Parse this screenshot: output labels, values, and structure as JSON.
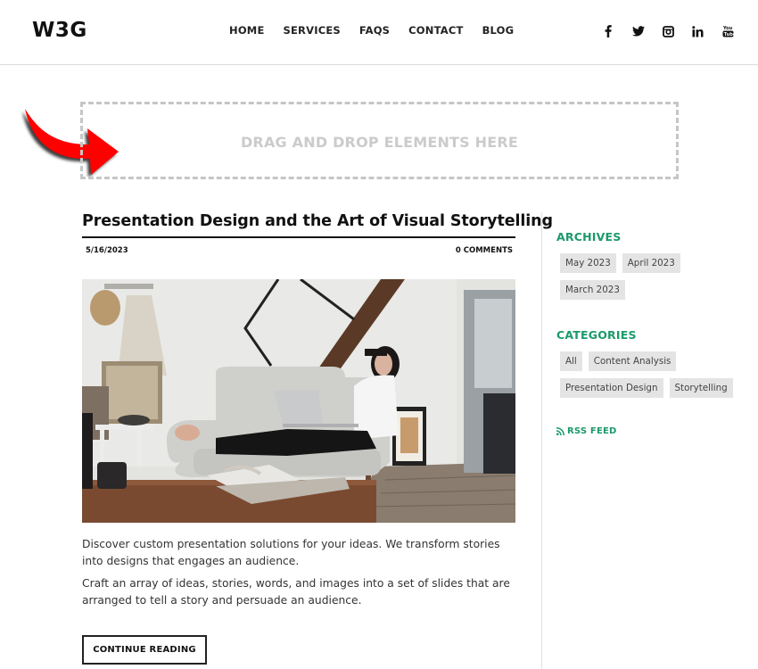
{
  "header": {
    "logo": "W3G",
    "nav": [
      "HOME",
      "SERVICES",
      "FAQS",
      "CONTACT",
      "BLOG"
    ],
    "social": [
      "facebook-icon",
      "twitter-icon",
      "instagram-icon",
      "linkedin-icon",
      "youtube-icon"
    ]
  },
  "dropzone": {
    "text": "DRAG AND DROP ELEMENTS HERE",
    "arrow_color": "#ff0000"
  },
  "post": {
    "title": "Presentation Design and the Art of Visual Storytelling",
    "date": "5/16/2023",
    "comments": "0 COMMENTS",
    "image_alt": "Woman with laptop sitting on grey sofa in living room",
    "paragraphs": [
      "Discover custom presentation solutions for your ideas. We transform stories into designs that engages an audience.",
      "Craft an array of ideas, stories, words, and images into a set of slides that are arranged to tell a story and persuade an audience."
    ],
    "continue_label": "CONTINUE READING"
  },
  "sidebar": {
    "accent_color": "#1a9a6a",
    "archives": {
      "title": "ARCHIVES",
      "items": [
        "May 2023",
        "April 2023",
        "March 2023"
      ]
    },
    "categories": {
      "title": "CATEGORIES",
      "items": [
        "All",
        "Content Analysis",
        "Presentation Design",
        "Storytelling"
      ]
    },
    "rss_label": "RSS FEED"
  }
}
